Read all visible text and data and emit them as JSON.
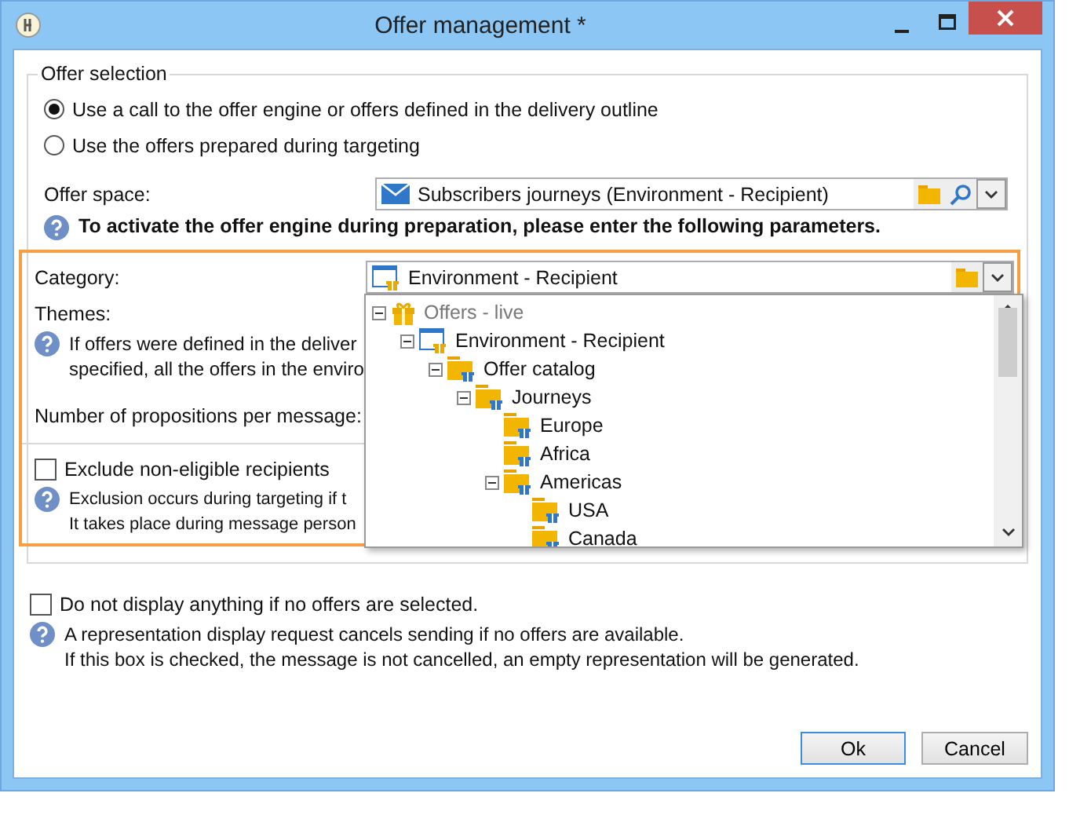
{
  "window": {
    "title": "Offer management *"
  },
  "offer_selection": {
    "legend": "Offer selection",
    "options": [
      {
        "label": "Use a call to the offer engine or offers defined in the delivery outline",
        "selected": true
      },
      {
        "label": "Use the offers prepared during targeting",
        "selected": false
      }
    ],
    "offer_space": {
      "label": "Offer space:",
      "value": "Subscribers journeys (Environment - Recipient)"
    },
    "notice": "To activate the offer engine during preparation, please enter the following parameters."
  },
  "parameters": {
    "category": {
      "label": "Category:",
      "value": "Environment - Recipient"
    },
    "themes_label": "Themes:",
    "themes_help": [
      "If offers were defined in the deliver",
      "specified, all the offers in the enviro"
    ],
    "propositions_label": "Number of propositions per message:",
    "exclude": {
      "label": "Exclude non-eligible recipients",
      "checked": false
    },
    "exclude_help": [
      "Exclusion occurs during targeting if t",
      "It takes place during message person"
    ]
  },
  "category_tree": [
    {
      "label": "Offers - live",
      "kind": "gift",
      "disabled": true,
      "expanded": true,
      "children": [
        {
          "label": "Environment - Recipient",
          "kind": "environment",
          "disabled": false,
          "expanded": true,
          "children": [
            {
              "label": "Offer catalog",
              "kind": "folder",
              "disabled": false,
              "expanded": true,
              "children": [
                {
                  "label": "Journeys",
                  "kind": "folder",
                  "disabled": false,
                  "expanded": true,
                  "children": [
                    {
                      "label": "Europe",
                      "kind": "folder",
                      "disabled": false
                    },
                    {
                      "label": "Africa",
                      "kind": "folder",
                      "disabled": false
                    },
                    {
                      "label": "Americas",
                      "kind": "folder",
                      "disabled": false,
                      "expanded": true,
                      "children": [
                        {
                          "label": "USA",
                          "kind": "folder",
                          "disabled": false
                        },
                        {
                          "label": "Canada",
                          "kind": "folder",
                          "disabled": false
                        }
                      ]
                    }
                  ]
                }
              ]
            }
          ]
        }
      ]
    }
  ],
  "no_display": {
    "label": "Do not display anything if no offers are selected.",
    "checked": false
  },
  "no_display_help": [
    "A representation display request cancels sending if no offers are available.",
    "If this box is checked, the message is not cancelled, an empty representation will be generated."
  ],
  "buttons": [
    {
      "label": "Ok",
      "default": true
    },
    {
      "label": "Cancel",
      "default": false
    }
  ]
}
